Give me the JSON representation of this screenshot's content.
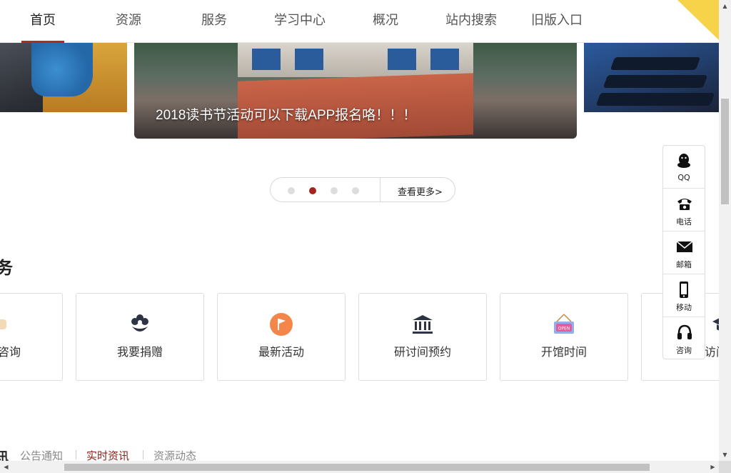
{
  "nav": {
    "items": [
      "首页",
      "资源",
      "服务",
      "学习中心",
      "概况",
      "站内搜索",
      "旧版入口"
    ],
    "active_index": 0,
    "accent": "#b32a22"
  },
  "carousel": {
    "caption": "2018读书节活动可以下载APP报名咯！！！",
    "dots": 4,
    "active_dot": 1,
    "more_label": "查看更多>",
    "active_color": "#a2261e"
  },
  "services": {
    "title": "务",
    "cards": [
      {
        "label": "咨询",
        "icon": "chat-bubble-icon"
      },
      {
        "label": "我要捐赠",
        "icon": "flower-icon"
      },
      {
        "label": "最新活动",
        "icon": "flag-icon"
      },
      {
        "label": "研讨间预约",
        "icon": "building-icon"
      },
      {
        "label": "开馆时间",
        "icon": "open-sign-icon"
      },
      {
        "label": "访问",
        "icon": "graduation-cap-icon"
      }
    ]
  },
  "float_bar": {
    "items": [
      {
        "label": "QQ",
        "icon": "qq-icon"
      },
      {
        "label": "电话",
        "icon": "phone-icon"
      },
      {
        "label": "邮箱",
        "icon": "mail-icon"
      },
      {
        "label": "移动",
        "icon": "mobile-icon"
      },
      {
        "label": "咨询",
        "icon": "headset-icon"
      }
    ]
  },
  "news": {
    "tabs": [
      "公告通知",
      "实时资讯",
      "资源动态"
    ],
    "active_index": 1,
    "active_color": "#8a2018"
  }
}
